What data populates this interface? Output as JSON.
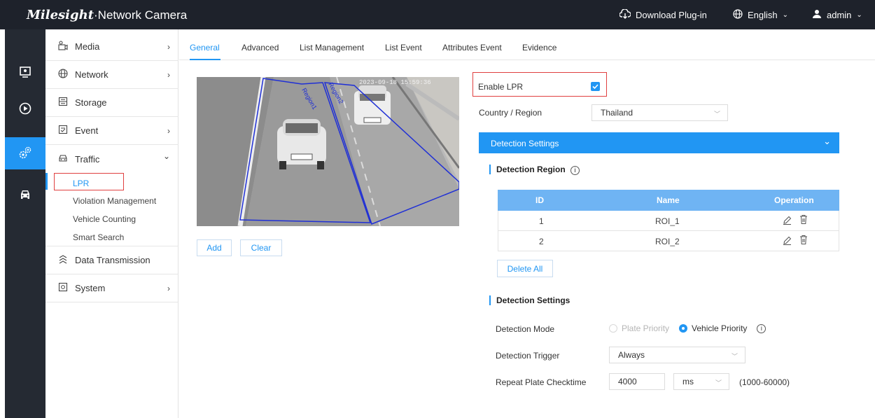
{
  "topbar": {
    "brand": "Milesight",
    "product": "·Network Camera",
    "download": "Download Plug-in",
    "language": "English",
    "user": "admin"
  },
  "rail": [
    "monitor-icon",
    "playback-icon",
    "settings-icon",
    "vehicle-icon"
  ],
  "sidebar": {
    "items": [
      {
        "label": "Media",
        "icon": "media-icon",
        "arrow": "›"
      },
      {
        "label": "Network",
        "icon": "globe-icon",
        "arrow": "›"
      },
      {
        "label": "Storage",
        "icon": "storage-icon",
        "arrow": ""
      },
      {
        "label": "Event",
        "icon": "event-icon",
        "arrow": "›"
      },
      {
        "label": "Traffic",
        "icon": "car-icon",
        "arrow": "⌄"
      },
      {
        "label": "Data Transmission",
        "icon": "transmission-icon",
        "arrow": ""
      },
      {
        "label": "System",
        "icon": "system-icon",
        "arrow": "›"
      }
    ],
    "traffic_sub": [
      "LPR",
      "Violation Management",
      "Vehicle Counting",
      "Smart Search"
    ]
  },
  "tabs": [
    "General",
    "Advanced",
    "List Management",
    "List Event",
    "Attributes Event",
    "Evidence"
  ],
  "video": {
    "timestamp": "2023-09-18 15:59:36",
    "regions": [
      "Region1",
      "Region2"
    ]
  },
  "buttons": {
    "add": "Add",
    "clear": "Clear",
    "delete_all": "Delete All"
  },
  "lpr": {
    "enable_label": "Enable LPR",
    "enabled": true,
    "country_label": "Country / Region",
    "country_value": "Thailand",
    "detection_settings_bar": "Detection Settings",
    "detection_region_title": "Detection Region",
    "table": {
      "headers": [
        "ID",
        "Name",
        "Operation"
      ],
      "rows": [
        {
          "id": "1",
          "name": "ROI_1"
        },
        {
          "id": "2",
          "name": "ROI_2"
        }
      ]
    },
    "detection_settings_title": "Detection Settings",
    "mode_label": "Detection Mode",
    "mode_options": [
      "Plate Priority",
      "Vehicle Priority"
    ],
    "mode_selected": "Vehicle Priority",
    "trigger_label": "Detection Trigger",
    "trigger_value": "Always",
    "repeat_label": "Repeat Plate Checktime",
    "repeat_value": "4000",
    "repeat_unit": "ms",
    "repeat_range": "(1000-60000)"
  },
  "colors": {
    "accent": "#2196f3",
    "topbar": "#1e222b",
    "rail": "#252a33",
    "highlight": "#e04040"
  }
}
